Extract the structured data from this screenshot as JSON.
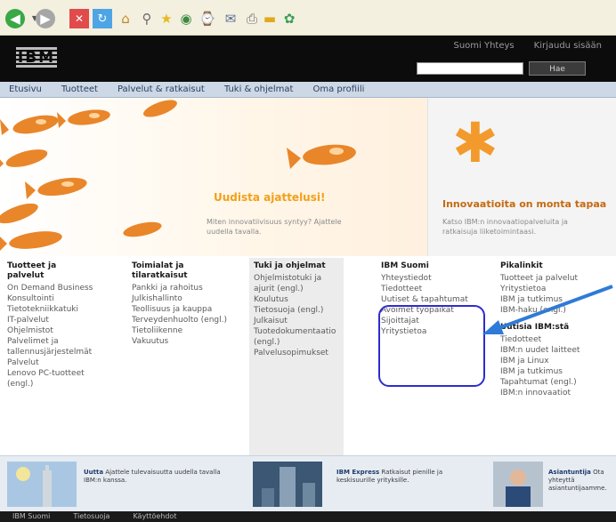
{
  "toolbar": {
    "buttons": [
      "back-icon",
      "forward-icon",
      "stop-icon",
      "refresh-icon",
      "home-icon",
      "search-icon",
      "favorites-icon",
      "media-icon",
      "history-icon",
      "mail-icon",
      "print-icon",
      "edit-icon",
      "messenger-icon"
    ]
  },
  "header": {
    "logo": "IBM",
    "links": [
      "Suomi  Yhteys",
      "Kirjaudu sisään"
    ],
    "search_button": "Hae"
  },
  "nav": [
    "Etusivu",
    "Tuotteet",
    "Palvelut & ratkaisut",
    "Tuki & ohjelmat",
    "Oma profiili"
  ],
  "hero": {
    "headline": "Uudista ajattelusi!",
    "subtext": "Miten innovatiivisuus syntyy? Ajattele uudella tavalla.",
    "right_headline": "Innovaatioita on monta tapaa",
    "right_subtext": "Katso IBM:n innovaatiopalveluita ja ratkaisuja liiketoimintaasi."
  },
  "columns": [
    {
      "title": "Tuotteet ja palvelut",
      "items": [
        "On Demand Business",
        "Konsultointi",
        "Tietotekniikkatuki",
        "IT-palvelut",
        "Ohjelmistot",
        "Palvelimet ja tallennusjärjestelmät",
        "Palvelut",
        "Lenovo PC-tuotteet (engl.)"
      ]
    },
    {
      "title": "Toimialat ja tilaratkaisut",
      "items": [
        "Pankki ja rahoitus",
        "Julkishallinto",
        "Teollisuus ja kauppa",
        "Terveydenhuolto (engl.)",
        "Tietoliikenne",
        "Vakuutus"
      ]
    },
    {
      "title": "Tuki ja ohjelmat",
      "items": [
        "Ohjelmistotuki ja ajurit (engl.)",
        "Koulutus",
        "Tietosuoja (engl.)",
        "Julkaisut",
        "Tuotedokumentaatio (engl.)",
        "Palvelusopimukset"
      ]
    },
    {
      "title": "IBM Suomi",
      "items": [
        "Yhteystiedot",
        "Tiedotteet",
        "Uutiset & tapahtumat",
        "Avoimet työpaikat",
        "Sijoittajat",
        "Yritystietoa"
      ]
    },
    {
      "title": "Pikalinkit",
      "items": [
        "Tuotteet ja palvelut",
        "Yritystietoa",
        "IBM ja tutkimus",
        "IBM-haku (engl.)"
      ]
    },
    {
      "title": "Uutisia IBM:stä",
      "items": [
        "Tiedotteet",
        "IBM:n uudet laitteet",
        "IBM ja Linux",
        "IBM ja tutkimus",
        "Tapahtumat (engl.)",
        "IBM:n innovaatiot"
      ]
    }
  ],
  "promo": [
    {
      "title": "Uutta",
      "text": "Ajattele tulevaisuutta uudella tavalla IBM:n kanssa."
    },
    {
      "title": "IBM Express",
      "text": "Ratkaisut pienille ja keskisuurille yrityksille."
    },
    {
      "title": "Asiantuntija",
      "text": "Ota yhteyttä asiantuntijaamme."
    }
  ],
  "footer": [
    "IBM Suomi",
    "Tietosuoja",
    "Käyttöehdot"
  ],
  "colors": {
    "header_bg": "#0c0c0c",
    "nav_bg": "#cdd8e6",
    "accent_orange": "#f2a018",
    "highlight_blue": "#2c2cd1",
    "arrow_blue": "#2f7ad8"
  }
}
